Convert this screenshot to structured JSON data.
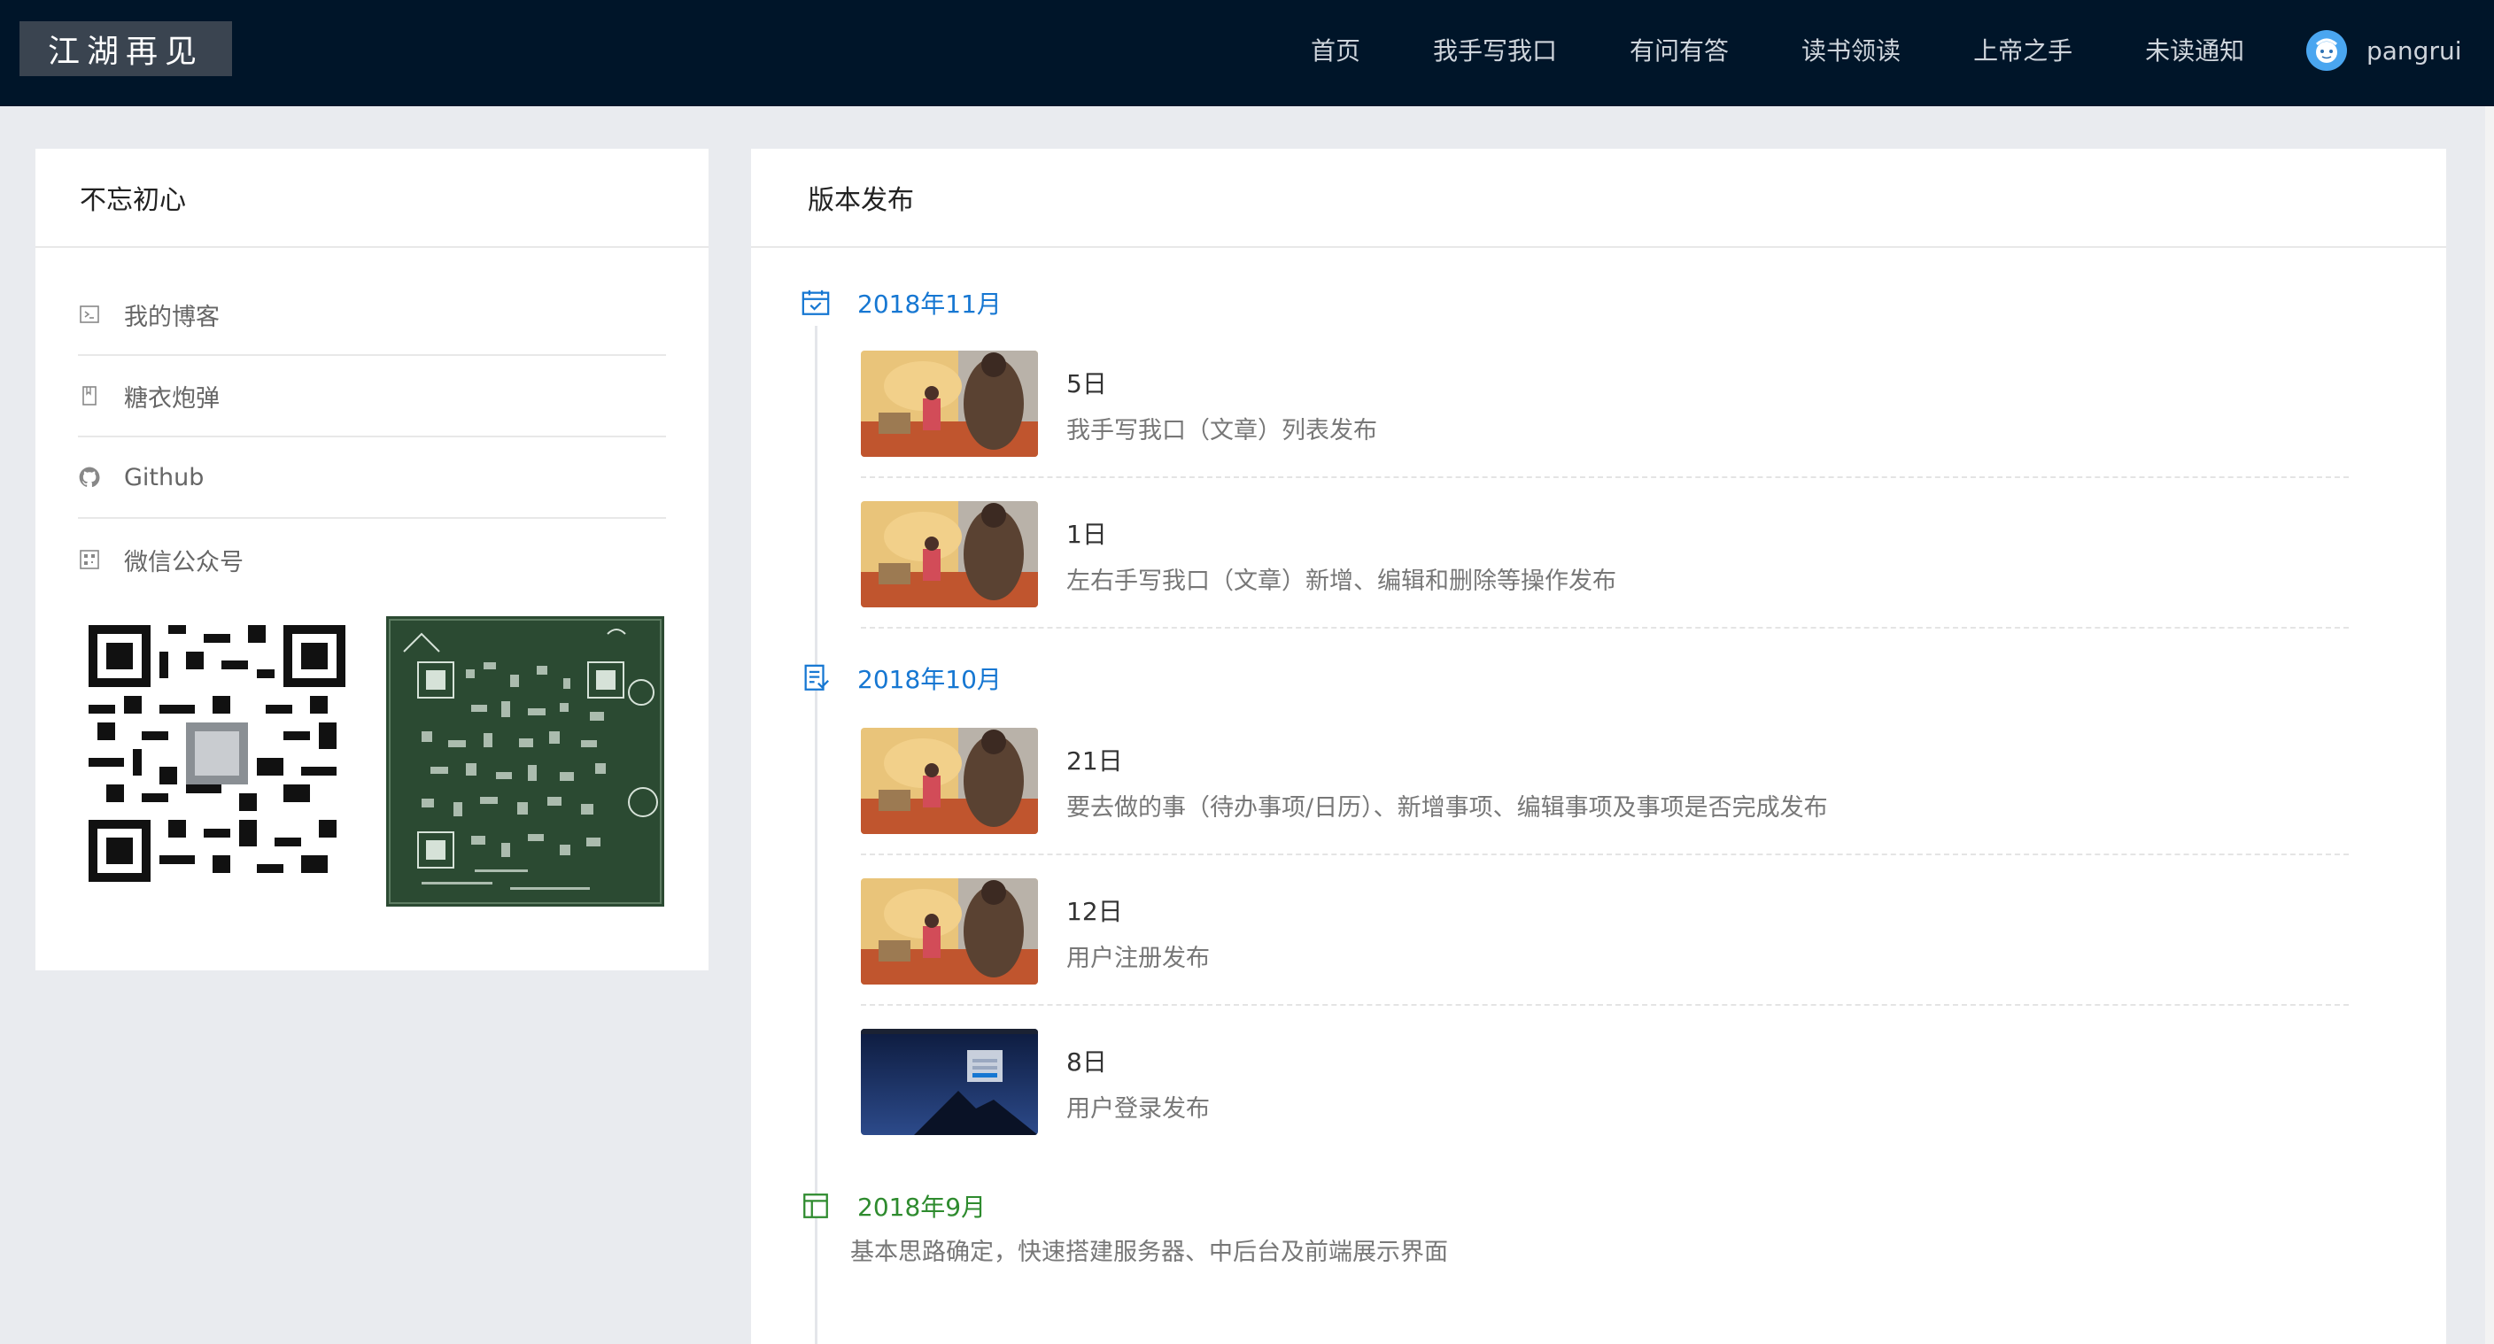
{
  "header": {
    "logo": "江湖再见",
    "nav": [
      "首页",
      "我手写我口",
      "有问有答",
      "读书领读",
      "上帝之手",
      "未读通知"
    ],
    "username": "pangrui",
    "colors": {
      "background": "#001529",
      "nav_text": "#cfd5dc",
      "avatar": "#4aa6f0"
    }
  },
  "left_card": {
    "title": "不忘初心",
    "menu": [
      {
        "icon": "terminal-icon",
        "label": "我的博客"
      },
      {
        "icon": "book-icon",
        "label": "糖衣炮弹"
      },
      {
        "icon": "github-icon",
        "label": "Github"
      },
      {
        "icon": "qrcode-icon",
        "label": "微信公众号"
      }
    ]
  },
  "right_card": {
    "title": "版本发布",
    "months": [
      {
        "label": "2018年11月",
        "icon": "calendar-check-icon",
        "color": "#1677d2"
      },
      {
        "label": "2018年10月",
        "icon": "list-doc-icon",
        "color": "#1677d2"
      },
      {
        "label": "2018年9月",
        "icon": "layout-icon",
        "color": "#2e8b2e",
        "note": "基本思路确定，快速搭建服务器、中后台及前端展示界面"
      }
    ],
    "entries": [
      {
        "day": "5日",
        "desc": "我手写我口（文章）列表发布",
        "thumb": "illustration"
      },
      {
        "day": "1日",
        "desc": "左右手写我口（文章）新增、编辑和删除等操作发布",
        "thumb": "illustration"
      },
      {
        "day": "21日",
        "desc": "要去做的事（待办事项/日历）、新增事项、编辑事项及事项是否完成发布",
        "thumb": "illustration"
      },
      {
        "day": "12日",
        "desc": "用户注册发布",
        "thumb": "illustration"
      },
      {
        "day": "8日",
        "desc": "用户登录发布",
        "thumb": "night-sky"
      }
    ]
  }
}
